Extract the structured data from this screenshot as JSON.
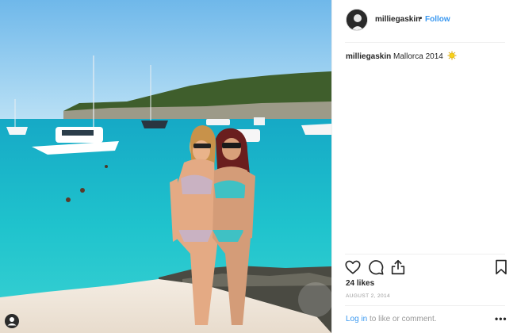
{
  "post": {
    "username": "milliegaskin",
    "header_separator": "•",
    "follow_label": "Follow",
    "caption_user": "milliegaskin",
    "caption_text": "Mallorca 2014",
    "caption_emoji": "sun-emoji",
    "likes_text": "24 likes",
    "date_text": "AUGUST 2, 2014",
    "login_link": "Log in",
    "login_rest": "to like or comment.",
    "more_label": "•••"
  },
  "icons": {
    "like": "heart-icon",
    "comment": "comment-icon",
    "share": "share-icon",
    "save": "bookmark-icon"
  },
  "colors": {
    "link": "#3897f0",
    "text": "#262626",
    "muted": "#999999",
    "water": "#1fb7c4",
    "sky": "#8ecdf0"
  }
}
